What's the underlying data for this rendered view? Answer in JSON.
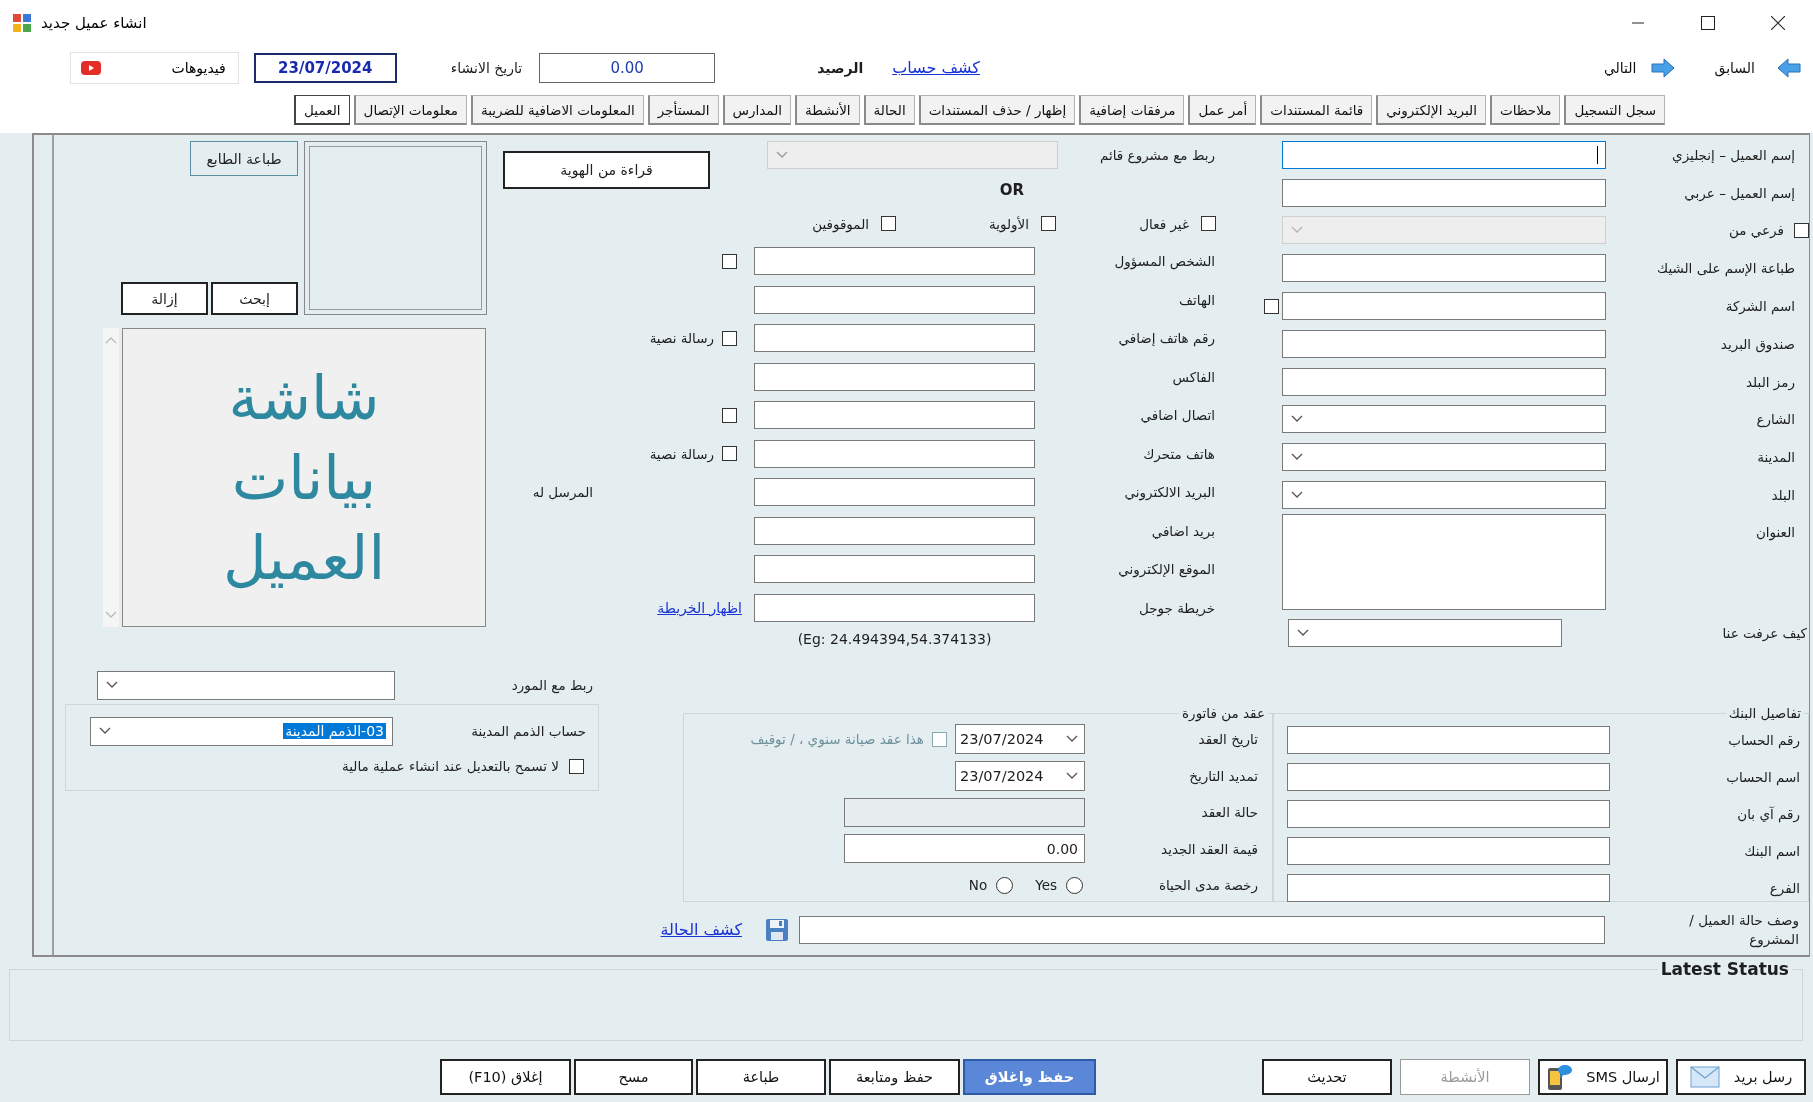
{
  "window": {
    "title": "انشاء عميل جديد"
  },
  "toolbar": {
    "previous": "السابق",
    "next": "التالي",
    "statement_link": "كشف حساب",
    "balance_label": "الرصيد",
    "balance": "0.00",
    "created_label": "تاريخ الانشاء",
    "created_date": "23/07/2024",
    "videos": "فيديوهات"
  },
  "tabs": [
    {
      "label": "سجل التسجيل",
      "selected": false
    },
    {
      "label": "ملاحظات",
      "selected": false
    },
    {
      "label": "البريد الإلكتروني",
      "selected": false
    },
    {
      "label": "قائمة المستندات",
      "selected": false
    },
    {
      "label": "أمر عمل",
      "selected": false
    },
    {
      "label": "مرفقات إضافية",
      "selected": false
    },
    {
      "label": "إظهار / حذف المستندات",
      "selected": false
    },
    {
      "label": "الحالة",
      "selected": false
    },
    {
      "label": "الأنشطة",
      "selected": false
    },
    {
      "label": "المدارس",
      "selected": false
    },
    {
      "label": "المستأجر",
      "selected": false
    },
    {
      "label": "المعلومات الاضافية للضريبة",
      "selected": false
    },
    {
      "label": "معلومات الإتصال",
      "selected": false
    },
    {
      "label": "العميل",
      "selected": true
    }
  ],
  "customer_fields": [
    {
      "label": "إسم العميل – إنجليزي",
      "kind": "text",
      "focused": true,
      "disabled": false
    },
    {
      "label": "إسم العميل – عربي",
      "kind": "text",
      "focused": false,
      "disabled": false
    },
    {
      "label": "فرعي من",
      "kind": "combo",
      "focused": false,
      "disabled": true,
      "label_checkbox": {
        "checked": false
      }
    },
    {
      "label": "طباعة الإسم على الشيك",
      "kind": "text",
      "focused": false,
      "disabled": false
    },
    {
      "label": "اسم الشركة",
      "kind": "text",
      "focused": false,
      "disabled": false,
      "side_checkbox": {
        "checked": false
      }
    },
    {
      "label": "صندوق البريد",
      "kind": "text",
      "focused": false,
      "disabled": false
    },
    {
      "label": "رمز البلد",
      "kind": "text",
      "focused": false,
      "disabled": false
    },
    {
      "label": "الشارع",
      "kind": "combo",
      "focused": false,
      "disabled": false
    },
    {
      "label": "المدينة",
      "kind": "combo",
      "focused": false,
      "disabled": false
    },
    {
      "label": "البلد",
      "kind": "combo",
      "focused": false,
      "disabled": false
    },
    {
      "label": "العنوان",
      "kind": "memo",
      "focused": false,
      "disabled": false
    }
  ],
  "referral": {
    "label": "كيف عرفت عنا"
  },
  "project_link": {
    "label": "ربط مع مشروع قائم",
    "disabled": true
  },
  "or_text": "OR",
  "id_button": "قراءة من الهوية",
  "flags": [
    {
      "label": "غير فعال",
      "checked": false
    },
    {
      "label": "الأولوية",
      "checked": false
    },
    {
      "label": "الموقوفين",
      "checked": false
    }
  ],
  "contacts": [
    {
      "label": "الشخص المسؤول",
      "checkbox": {
        "checked": false
      }
    },
    {
      "label": "الهاتف"
    },
    {
      "label": "رقم هاتف إضافي",
      "checkbox": {
        "checked": false,
        "label": "رسالة نصية"
      }
    },
    {
      "label": "الفاكس"
    },
    {
      "label": "اتصال اضافي",
      "checkbox": {
        "checked": false
      }
    },
    {
      "label": "هاتف متحرك",
      "checkbox": {
        "checked": false,
        "label": "رسالة نصية"
      }
    },
    {
      "label": "البريد الالكتروني",
      "side_label": "المرسل له"
    },
    {
      "label": "بريد اضافي"
    },
    {
      "label": "الموقع الإلكتروني"
    },
    {
      "label": "خريطة جوجل",
      "link": "اظهار الخريطة",
      "hint": "(Eg: 24.494394,54.374133)"
    }
  ],
  "photo": {
    "print_button": "طباعة الطابع",
    "search_button": "إبحث",
    "remove_button": "إزالة",
    "banner": "شاشة بيانات العميل"
  },
  "supplier": {
    "label": "ربط مع المورد"
  },
  "receivables": {
    "label": "حساب الذمم المدينة",
    "value": "03-الذمم المدينة",
    "highlighted": true,
    "lock": {
      "label": "لا تسمح بالتعديل عند انشاء عملية مالية",
      "checked": false
    }
  },
  "contract": {
    "title": "عقد من فاتورة",
    "rows": [
      {
        "label": "تاريخ العقد",
        "kind": "date",
        "value": "23/07/2024",
        "checkbox": {
          "label": "هذا عقد صيانة سنوي ، / توقيف",
          "checked": false,
          "disabled": true
        }
      },
      {
        "label": "تمديد التاريخ",
        "kind": "date",
        "value": "23/07/2024"
      },
      {
        "label": "حالة العقد",
        "kind": "readonly"
      },
      {
        "label": "قيمة العقد الجديد",
        "kind": "number",
        "value": "0.00"
      },
      {
        "label": "رخصة مدى الحياة",
        "kind": "radios",
        "options": [
          {
            "label": "Yes",
            "selected": false
          },
          {
            "label": "No",
            "selected": false
          }
        ]
      }
    ]
  },
  "bank": {
    "title": "تفاصيل البنك",
    "fields": [
      {
        "label": "رقم الحساب"
      },
      {
        "label": "اسم الحساب"
      },
      {
        "label": "رقم آي بان"
      },
      {
        "label": "اسم البنك"
      },
      {
        "label": "الفرع"
      }
    ]
  },
  "status": {
    "label": "وصف حالة العميل / المشروع",
    "link": "كشف الحالة"
  },
  "latest_status": {
    "title": "Latest Status"
  },
  "side_actions": [
    {
      "label": "رسل بريد",
      "kind": "mail",
      "disabled": false
    },
    {
      "label": "ارسال SMS",
      "kind": "sms",
      "disabled": false
    },
    {
      "label": "الأنشطة",
      "kind": "plain",
      "disabled": true
    },
    {
      "label": "تحديث",
      "kind": "plain",
      "disabled": false
    }
  ],
  "form_actions": [
    {
      "label": "حفظ واغلاق",
      "kind": "primary",
      "disabled": false
    },
    {
      "label": "حفظ ومتابعة",
      "kind": "plain",
      "disabled": false
    },
    {
      "label": "طباعة",
      "kind": "plain",
      "disabled": false
    },
    {
      "label": "مسح",
      "kind": "plain",
      "disabled": false
    },
    {
      "label": "إغلاق (F10)",
      "kind": "plain",
      "disabled": false
    }
  ]
}
